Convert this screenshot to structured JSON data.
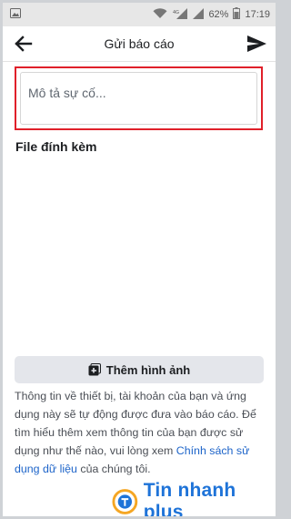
{
  "status_bar": {
    "battery": "62%",
    "time": "17:19",
    "signal_label": "4G"
  },
  "header": {
    "title": "Gửi báo cáo",
    "back_icon": "arrow-left-icon",
    "send_icon": "send-icon"
  },
  "description": {
    "placeholder": "Mô tả sự cố..."
  },
  "attachments": {
    "title": "File đính kèm",
    "add_image_label": "Thêm hình ảnh",
    "add_image_icon": "add-photo-icon"
  },
  "info": {
    "text_before": "Thông tin về thiết bị, tài khoản của bạn và ứng dụng này sẽ tự động được đưa vào báo cáo. Để tìm hiểu thêm xem thông tin của bạn được sử dụng như thế nào, vui lòng xem ",
    "link": "Chính sách sử dụng dữ liệu",
    "text_after": " của chúng tôi."
  },
  "watermark": {
    "text": "Tin nhanh plus",
    "colors": {
      "primary": "#1e73d8",
      "accent": "#f5a623"
    }
  },
  "colors": {
    "highlight_border": "#e0202a",
    "link": "#1d64c9",
    "button_bg": "#e4e6eb"
  }
}
